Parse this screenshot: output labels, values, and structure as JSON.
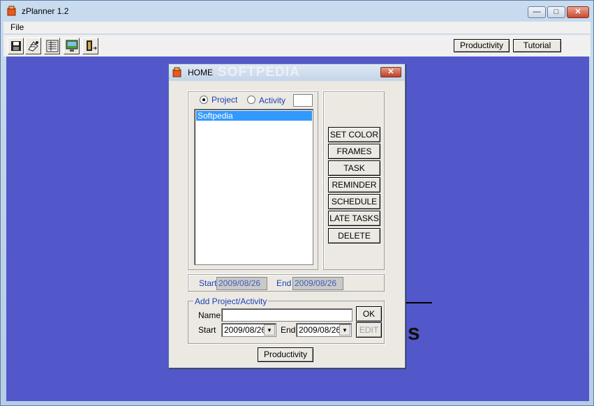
{
  "app": {
    "title": "zPlanner 1.2",
    "window_controls": {
      "minimize": "—",
      "maximize": "□",
      "close": "✕"
    }
  },
  "menu": {
    "items": [
      {
        "label": "File"
      }
    ]
  },
  "toolbar": {
    "icons": [
      "floppy-disk-icon",
      "open-tools-icon",
      "list-icon",
      "monitor-picture-icon",
      "exit-icon"
    ],
    "productivity_label": "Productivity",
    "tutorial_label": "Tutorial"
  },
  "background": {
    "text": "is"
  },
  "dialog": {
    "title": "HOME",
    "watermark": "SOFTPEDIA",
    "close_glyph": "✕",
    "radio_project": "Project",
    "radio_activity": "Activity",
    "selected_radio": "project",
    "list_items": [
      "Softpedia"
    ],
    "buttons": {
      "set_color": "SET COLOR",
      "frames": "FRAMES",
      "task": "TASK",
      "reminder": "REMINDER",
      "schedule": "SCHEDULE",
      "late_tasks": "LATE TASKS",
      "delete": "DELETE"
    },
    "start_label": "Start",
    "start_value": "2009/08/26",
    "end_label": "End",
    "end_value": "2009/08/26",
    "add_group": {
      "legend": "Add Project/Activity",
      "name_label": "Name",
      "name_value": "",
      "ok_label": "OK",
      "start_label": "Start",
      "start_value": "2009/08/26",
      "end_label": "End",
      "end_value": "2009/08/26",
      "edit_label": "EDIT"
    },
    "productivity_label": "Productivity"
  },
  "colors": {
    "workspace": "#5258c9",
    "selection": "#3399ff",
    "label_blue": "#1c3fb1"
  }
}
